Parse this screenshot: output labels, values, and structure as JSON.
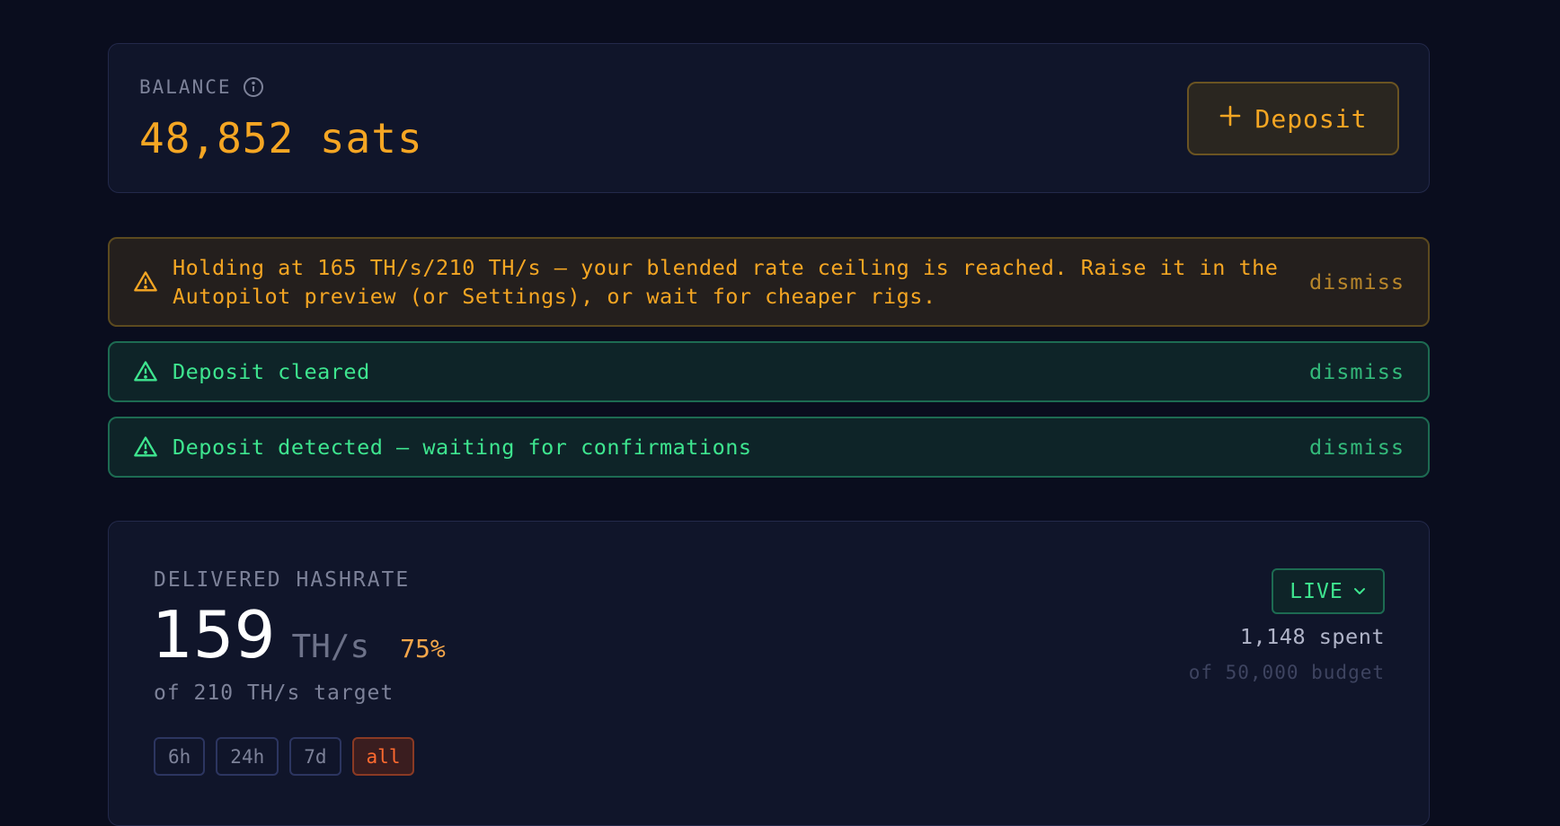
{
  "balance": {
    "label": "BALANCE",
    "value": "48,852 sats",
    "deposit_label": "Deposit"
  },
  "alerts": [
    {
      "type": "warning",
      "text": "Holding at 165 TH/s/210 TH/s — your blended rate ceiling is reached. Raise it in the Autopilot preview (or Settings), or wait for cheaper rigs.",
      "dismiss": "dismiss"
    },
    {
      "type": "success",
      "text": "Deposit cleared",
      "dismiss": "dismiss"
    },
    {
      "type": "success",
      "text": "Deposit detected — waiting for confirmations",
      "dismiss": "dismiss"
    }
  ],
  "hashrate": {
    "label": "DELIVERED HASHRATE",
    "value": "159",
    "unit": "TH/s",
    "percent": "75%",
    "target_text": "of 210 TH/s target",
    "mode": "LIVE",
    "spent": "1,148 spent",
    "budget": "of 50,000 budget",
    "ranges": [
      "6h",
      "24h",
      "7d",
      "all"
    ],
    "active_range": "all"
  },
  "colors": {
    "background": "#0a0d1e",
    "accent_amber": "#f5a623",
    "success_green": "#3ee58f",
    "active_orange": "#ff6a2f"
  },
  "icons": {
    "info": "info-icon",
    "plus": "plus-icon",
    "warning": "warning-triangle-icon",
    "chevron": "chevron-down-icon"
  }
}
